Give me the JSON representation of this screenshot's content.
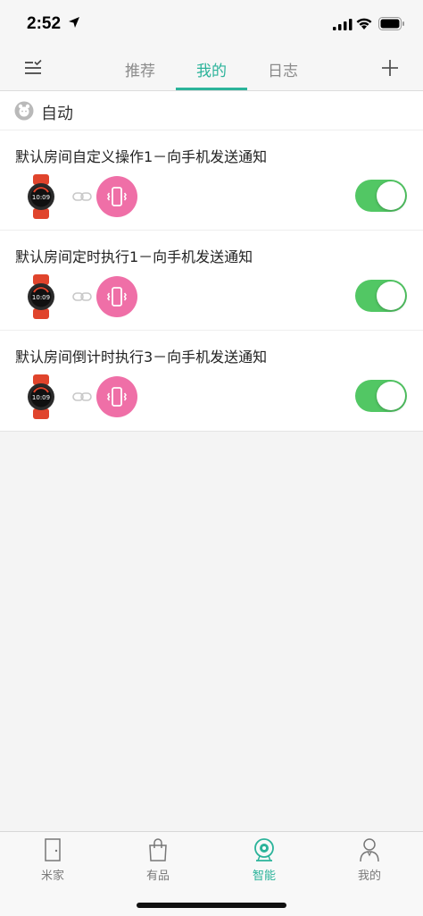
{
  "status_bar": {
    "time": "2:52"
  },
  "header": {
    "tabs": [
      {
        "label": "推荐",
        "active": false
      },
      {
        "label": "我的",
        "active": true
      },
      {
        "label": "日志",
        "active": false
      }
    ],
    "accent_color": "#2bb39a"
  },
  "section": {
    "title": "自动",
    "rules": [
      {
        "title": "默认房间自定义操作1－向手机发送通知",
        "trigger_icon": "watch-icon",
        "action_icon": "phone-vibrate-icon",
        "enabled": true
      },
      {
        "title": "默认房间定时执行1－向手机发送通知",
        "trigger_icon": "watch-icon",
        "action_icon": "phone-vibrate-icon",
        "enabled": true
      },
      {
        "title": "默认房间倒计时执行3－向手机发送通知",
        "trigger_icon": "watch-icon",
        "action_icon": "phone-vibrate-icon",
        "enabled": true
      }
    ]
  },
  "tabbar": {
    "items": [
      {
        "label": "米家",
        "icon": "door-icon",
        "active": false
      },
      {
        "label": "有品",
        "icon": "bag-icon",
        "active": false
      },
      {
        "label": "智能",
        "icon": "smart-icon",
        "active": true
      },
      {
        "label": "我的",
        "icon": "person-icon",
        "active": false
      }
    ]
  },
  "colors": {
    "toggle_on": "#52c764",
    "action_badge": "#ef6fa7"
  }
}
